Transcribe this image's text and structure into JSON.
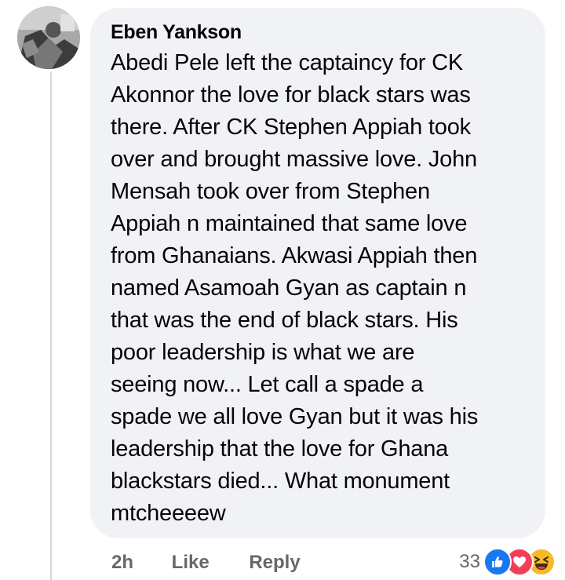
{
  "comment": {
    "author": "Eben Yankson",
    "text": "Abedi Pele left the captaincy for CK\nAkonnor the love for black stars was\nthere. After CK Stephen Appiah took\nover and brought massive love. John\nMensah took over from Stephen\nAppiah n maintained that same love\nfrom Ghanaians. Akwasi Appiah then\nnamed Asamoah Gyan as captain n\nthat was the end of black stars. His\npoor leadership is what we are\nseeing now... Let call a spade a\nspade we all love Gyan but it was his\nleadership that the love for Ghana\nblackstars died... What monument\nmtcheeeew",
    "timestamp": "2h",
    "like_label": "Like",
    "reply_label": "Reply",
    "reaction_count": "33",
    "reactions": [
      "like-icon",
      "love-icon",
      "haha-icon"
    ]
  },
  "colors": {
    "bubble": "#f0f2f5",
    "text": "#050505",
    "meta": "#65676b",
    "like": "#1877f2",
    "love": "#f33e58",
    "haha": "#f7b928"
  }
}
